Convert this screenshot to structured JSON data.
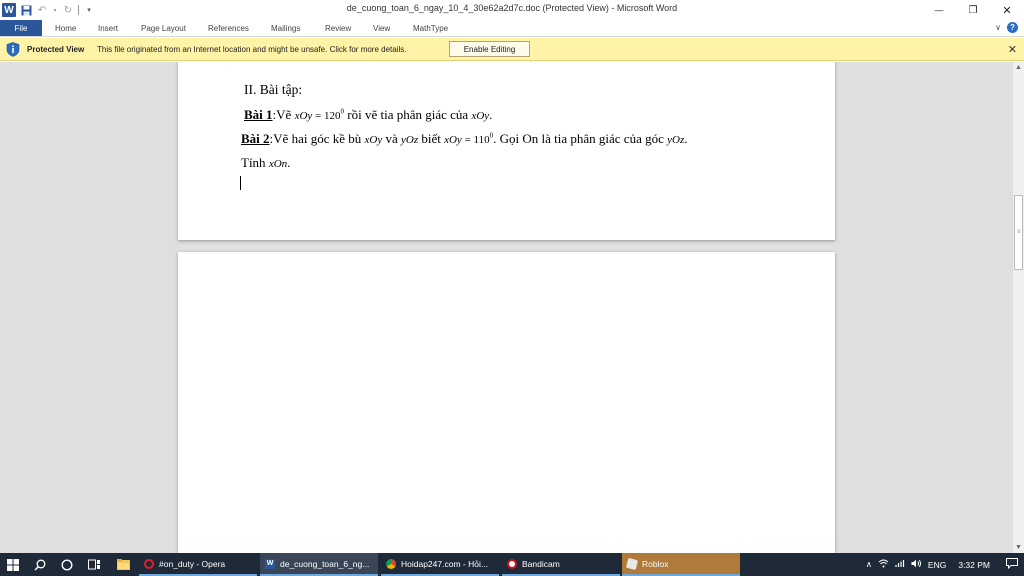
{
  "titlebar": {
    "title": "de_cuong_toan_6_ngay_10_4_30e62a2d7c.doc (Protected View)  -  Microsoft Word",
    "app_icon_letter": "W",
    "minimize": "—",
    "restore": "❐",
    "close": "✕"
  },
  "ribbon": {
    "tabs": [
      "File",
      "Home",
      "Insert",
      "Page Layout",
      "References",
      "Mailings",
      "Review",
      "View",
      "MathType"
    ],
    "help": "?",
    "collapse": "∨"
  },
  "protected_view": {
    "title": "Protected View",
    "message": "This file originated from an Internet location and might be unsafe. Click for more details.",
    "button": "Enable Editing",
    "close": "✕"
  },
  "document": {
    "heading": "II.  Bài tập:",
    "bai1_label": "Bài 1",
    "bai1_text_a": ":Vẽ ",
    "bai1_math1": "xOy",
    "bai1_eq": " = 120",
    "bai1_deg": "0",
    "bai1_text_b": " rồi vẽ tia phân giác của ",
    "bai1_math2": "xOy",
    "bai1_end": ".",
    "bai2_label": "Bài 2",
    "bai2_text_a": ":Vẽ hai góc kề bù ",
    "bai2_math1": "xOy",
    "bai2_text_b": "  và  ",
    "bai2_math2": "yOz",
    "bai2_text_c": "  biết  ",
    "bai2_math3": "xOy",
    "bai2_eq": " = 110",
    "bai2_deg": "0",
    "bai2_text_d": ". Gọi On là tia phân giác của góc  ",
    "bai2_math4": "yOz",
    "bai2_end": ".",
    "line3_text": "Tính  ",
    "line3_math": "xOn",
    "line3_end": "."
  },
  "taskbar": {
    "apps": [
      {
        "label": "#on_duty - Opera",
        "color": "#e0202a"
      },
      {
        "label": "de_cuong_toan_6_ng...",
        "color": "#2b579a"
      },
      {
        "label": "Hoidap247.com - Hỏi...",
        "color": "#f4b400"
      },
      {
        "label": "Bandicam",
        "color": "#d0101a"
      },
      {
        "label": "Roblox",
        "color": "#e8e8e8"
      }
    ],
    "language": "ENG",
    "time": "3:32 PM",
    "tray_icons": "∧  %)  ≈  ))"
  },
  "colors": {
    "word_blue": "#2b579a",
    "protected_bar": "#fff3a8",
    "taskbar": "#1f2a38",
    "doc_background": "#dfdfdf"
  }
}
